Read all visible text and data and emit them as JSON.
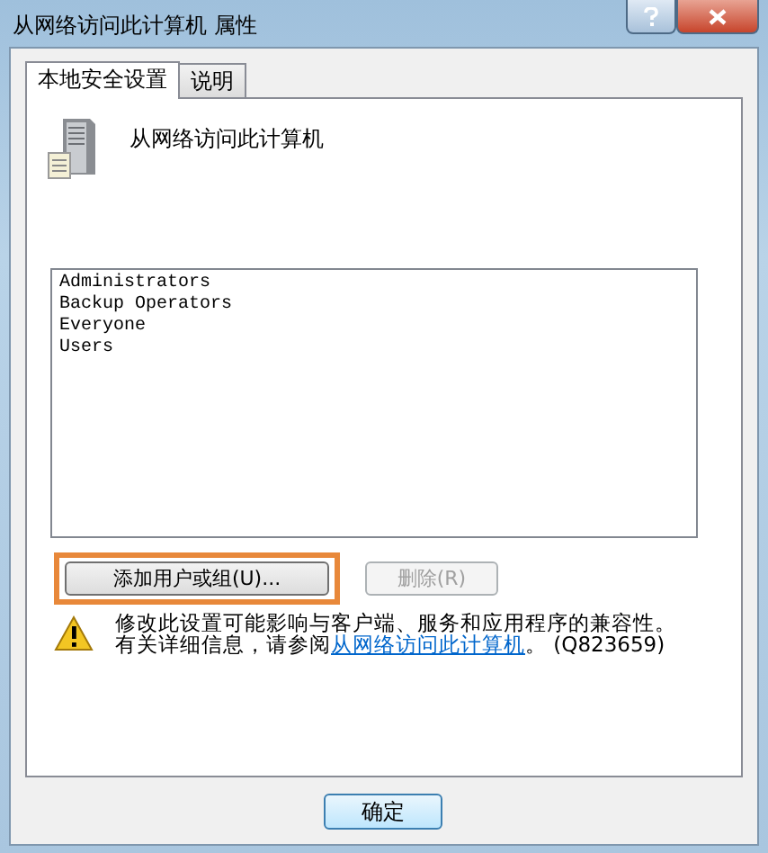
{
  "window": {
    "title": "从网络访问此计算机 属性"
  },
  "tabs": [
    {
      "label": "本地安全设置",
      "selected": true
    },
    {
      "label": "说明",
      "selected": false
    }
  ],
  "policy": {
    "title": "从网络访问此计算机"
  },
  "accounts": [
    "Administrators",
    "Backup Operators",
    "Everyone",
    "Users"
  ],
  "list_buttons": [
    {
      "label": "添加用户或组(U)...",
      "disabled": false,
      "highlighted": true
    },
    {
      "label": "删除(R)",
      "disabled": true,
      "highlighted": false
    }
  ],
  "warning": {
    "line_1": "修改此设置可能影响与客户端、服务和应用程序的兼容性。",
    "line_2_before": "有关详细信息，请参阅",
    "link": "从网络访问此计算机",
    "line_2_after": "。 (Q823659)"
  },
  "dialog_buttons": [
    {
      "label": "确定"
    }
  ]
}
